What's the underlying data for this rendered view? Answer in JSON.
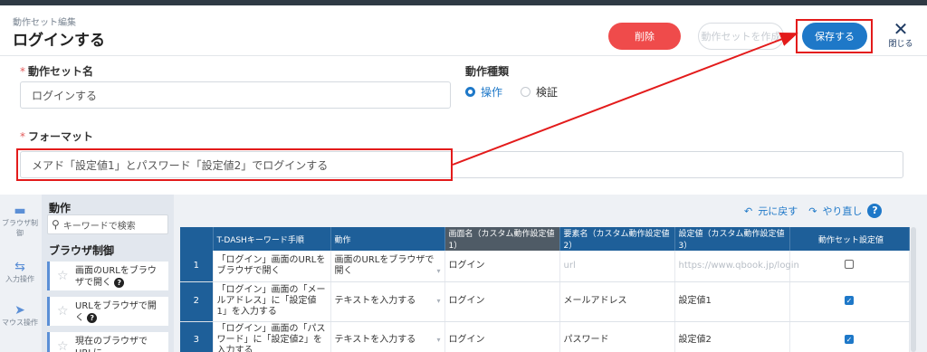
{
  "header": {
    "breadcrumb": "動作セット編集",
    "title": "ログインする",
    "delete_label": "削除",
    "create_set_label": "動作セットを作成",
    "save_label": "保存する",
    "close_label": "閉じる"
  },
  "form": {
    "name_label": "動作セット名",
    "name_value": "ログインする",
    "type_label": "動作種類",
    "type_options": [
      "操作",
      "検証"
    ],
    "format_label": "フォーマット",
    "format_value": "メアド「設定値1」とパスワード「設定値2」でログインする"
  },
  "rail": {
    "items": [
      "ブラウザ制御",
      "入力操作",
      "マウス操作"
    ]
  },
  "panel": {
    "title": "動作",
    "search_placeholder": "キーワードで検索",
    "section": "ブラウザ制御",
    "actions": [
      "画面のURLをブラウザで開く",
      "URLをブラウザで開く",
      "現在のブラウザでURLに"
    ]
  },
  "toolbar": {
    "undo": "元に戻す",
    "redo": "やり直し"
  },
  "table": {
    "headers": [
      "",
      "T-DASHキーワード手順",
      "動作",
      "画面名（カスタム動作設定値1）",
      "要素名（カスタム動作設定値2）",
      "設定値（カスタム動作設定値3）",
      "動作セット設定値"
    ],
    "rows": [
      {
        "num": "1",
        "step": "「ログイン」画面のURLをブラウザで開く",
        "action": "画面のURLをブラウザで開く",
        "screen": "ログイン",
        "element": "url",
        "value": "https://www.qbook.jp/login",
        "checked": false
      },
      {
        "num": "2",
        "step": "「ログイン」画面の「メールアドレス」に「設定値1」を入力する",
        "action": "テキストを入力する",
        "screen": "ログイン",
        "element": "メールアドレス",
        "value": "設定値1",
        "checked": true
      },
      {
        "num": "3",
        "step": "「ログイン」画面の「パスワード」に「設定値2」を入力する",
        "action": "テキストを入力する",
        "screen": "ログイン",
        "element": "パスワード",
        "value": "設定値2",
        "checked": true
      }
    ]
  },
  "colors": {
    "primary": "#1e78c8",
    "danger": "#ef4b4b",
    "highlight": "#e31b1b",
    "table_header": "#1e5f99"
  }
}
